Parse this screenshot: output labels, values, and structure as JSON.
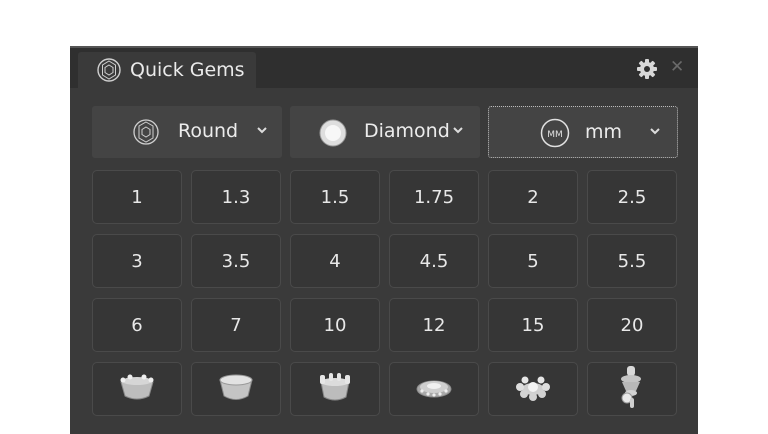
{
  "window": {
    "title": "Quick Gems"
  },
  "dropdowns": {
    "shape": {
      "value": "Round",
      "icon": "round-cut-icon"
    },
    "material": {
      "value": "Diamond",
      "icon": "diamond-gem-icon"
    },
    "unit": {
      "value": "mm",
      "icon": "millimeter-icon",
      "badge": "MM"
    }
  },
  "sizes": [
    "1",
    "1.3",
    "1.5",
    "1.75",
    "2",
    "2.5",
    "3",
    "3.5",
    "4",
    "4.5",
    "5",
    "5.5",
    "6",
    "7",
    "10",
    "12",
    "15",
    "20"
  ],
  "settings": [
    {
      "icon": "prong-setting-icon"
    },
    {
      "icon": "bezel-setting-icon"
    },
    {
      "icon": "crown-setting-icon"
    },
    {
      "icon": "halo-setting-icon"
    },
    {
      "icon": "flower-setting-icon"
    },
    {
      "icon": "cutter-tool-icon"
    }
  ]
}
